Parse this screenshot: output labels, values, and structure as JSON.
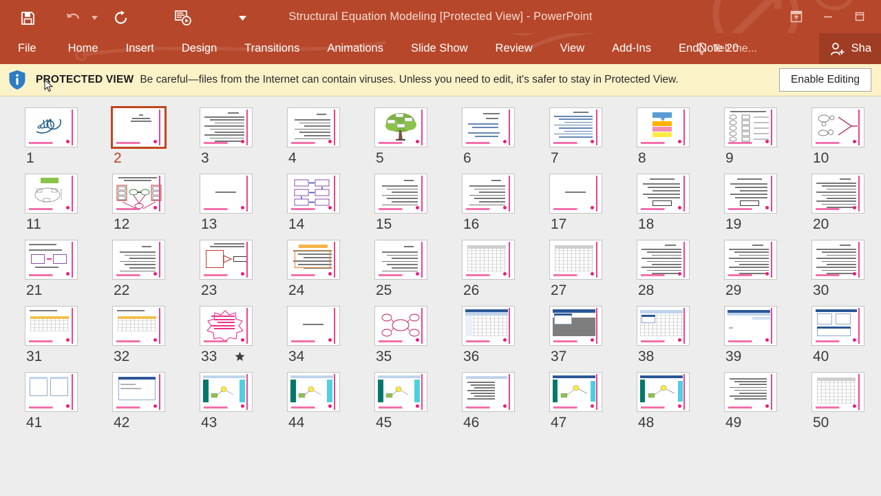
{
  "window": {
    "title": "Structural Equation Modeling [Protected View] - PowerPoint",
    "accent_color": "#b7472a",
    "quick_access": [
      {
        "name": "save",
        "icon": "save-icon"
      },
      {
        "name": "undo",
        "icon": "undo-icon"
      },
      {
        "name": "undo-dropdown",
        "icon": "chevron-down-icon"
      },
      {
        "name": "repeat",
        "icon": "repeat-icon"
      },
      {
        "name": "start-slideshow",
        "icon": "slideshow-icon"
      },
      {
        "name": "customize-quick-access-toolbar",
        "icon": "chevron-down-icon"
      }
    ],
    "controls": [
      {
        "name": "ribbon-display-options",
        "icon": "ribbon-options-icon"
      },
      {
        "name": "minimize",
        "icon": "minimize-icon"
      },
      {
        "name": "restore",
        "icon": "restore-icon"
      }
    ]
  },
  "ribbon": {
    "tabs": [
      {
        "label": "File"
      },
      {
        "label": "Home"
      },
      {
        "label": "Insert"
      },
      {
        "label": "Design"
      },
      {
        "label": "Transitions"
      },
      {
        "label": "Animations"
      },
      {
        "label": "Slide Show"
      },
      {
        "label": "Review"
      },
      {
        "label": "View"
      },
      {
        "label": "Add-Ins"
      },
      {
        "label": "EndNote 20"
      }
    ],
    "tell_me": "Tell me...",
    "share": "Sha"
  },
  "protected_view": {
    "title": "PROTECTED VIEW",
    "message": "Be careful—files from the Internet can contain viruses. Unless you need to edit, it's safer to stay in Protected View.",
    "enable_button": "Enable Editing",
    "background_color": "#fcf2c8",
    "shield_color": "#2d7cc4"
  },
  "slide_sorter": {
    "selected_slide": 2,
    "slides": [
      {
        "n": "1",
        "kind": "calligraphy"
      },
      {
        "n": "2",
        "kind": "title-short"
      },
      {
        "n": "3",
        "kind": "text-dense"
      },
      {
        "n": "4",
        "kind": "text-center"
      },
      {
        "n": "5",
        "kind": "tree"
      },
      {
        "n": "6",
        "kind": "text-blue"
      },
      {
        "n": "7",
        "kind": "text-blue-dense"
      },
      {
        "n": "8",
        "kind": "color-blocks"
      },
      {
        "n": "9",
        "kind": "shape-legend"
      },
      {
        "n": "10",
        "kind": "path-pink"
      },
      {
        "n": "11",
        "kind": "green-header-diagram"
      },
      {
        "n": "12",
        "kind": "sem-diagram"
      },
      {
        "n": "13",
        "kind": "title-only"
      },
      {
        "n": "14",
        "kind": "flow-purple"
      },
      {
        "n": "15",
        "kind": "text-center"
      },
      {
        "n": "16",
        "kind": "text-center"
      },
      {
        "n": "17",
        "kind": "title-only"
      },
      {
        "n": "18",
        "kind": "equation"
      },
      {
        "n": "19",
        "kind": "equation"
      },
      {
        "n": "20",
        "kind": "text-dense"
      },
      {
        "n": "21",
        "kind": "boxes-english"
      },
      {
        "n": "22",
        "kind": "text-center"
      },
      {
        "n": "23",
        "kind": "diagram-orange"
      },
      {
        "n": "24",
        "kind": "table-orange"
      },
      {
        "n": "25",
        "kind": "text-center"
      },
      {
        "n": "26",
        "kind": "table-plain"
      },
      {
        "n": "27",
        "kind": "table-plain"
      },
      {
        "n": "28",
        "kind": "text-dense"
      },
      {
        "n": "29",
        "kind": "text-dense"
      },
      {
        "n": "30",
        "kind": "text-dense"
      },
      {
        "n": "31",
        "kind": "table-mixed"
      },
      {
        "n": "32",
        "kind": "table-mixed"
      },
      {
        "n": "33",
        "kind": "starburst",
        "animated": true
      },
      {
        "n": "34",
        "kind": "title-only"
      },
      {
        "n": "35",
        "kind": "cloud-diagram"
      },
      {
        "n": "36",
        "kind": "spss-sheet"
      },
      {
        "n": "37",
        "kind": "spss-dialog-gray"
      },
      {
        "n": "38",
        "kind": "spss-sheet2"
      },
      {
        "n": "39",
        "kind": "spss-output"
      },
      {
        "n": "40",
        "kind": "spss-panels"
      },
      {
        "n": "41",
        "kind": "spss-dialog2"
      },
      {
        "n": "42",
        "kind": "spss-dialog3"
      },
      {
        "n": "43",
        "kind": "amos-graph"
      },
      {
        "n": "44",
        "kind": "amos-graph"
      },
      {
        "n": "45",
        "kind": "amos-graph"
      },
      {
        "n": "46",
        "kind": "spss-output2"
      },
      {
        "n": "47",
        "kind": "amos-chart"
      },
      {
        "n": "48",
        "kind": "amos-chart"
      },
      {
        "n": "49",
        "kind": "text-output"
      },
      {
        "n": "50",
        "kind": "table-plain"
      }
    ]
  }
}
